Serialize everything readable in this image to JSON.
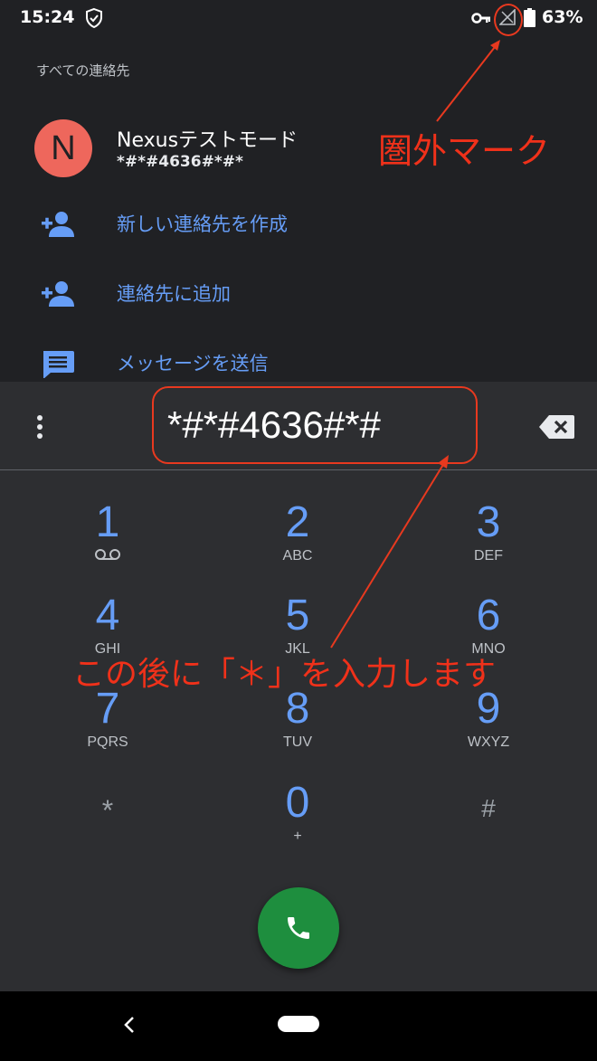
{
  "status_bar": {
    "time": "15:24",
    "battery_percent": "63%",
    "icons": [
      "shield-check-icon",
      "vpn-key-icon",
      "no-signal-icon",
      "battery-icon"
    ]
  },
  "suggestions": {
    "header": "すべての連絡先",
    "contact": {
      "avatar_letter": "N",
      "avatar_color": "#ee675c",
      "name": "Nexusテストモード",
      "number": "*#*#4636#*#*"
    },
    "actions": [
      {
        "label": "新しい連絡先を作成",
        "icon": "person-add-icon"
      },
      {
        "label": "連絡先に追加",
        "icon": "person-add-icon"
      },
      {
        "label": "メッセージを送信",
        "icon": "message-icon"
      }
    ]
  },
  "dialer": {
    "entered_digits": "*#*#4636#*#",
    "keys": [
      {
        "digit": "1",
        "sub": ""
      },
      {
        "digit": "2",
        "sub": "ABC"
      },
      {
        "digit": "3",
        "sub": "DEF"
      },
      {
        "digit": "4",
        "sub": "GHI"
      },
      {
        "digit": "5",
        "sub": "JKL"
      },
      {
        "digit": "6",
        "sub": "MNO"
      },
      {
        "digit": "7",
        "sub": "PQRS"
      },
      {
        "digit": "8",
        "sub": "TUV"
      },
      {
        "digit": "9",
        "sub": "WXYZ"
      },
      {
        "digit": "*",
        "sub": ""
      },
      {
        "digit": "0",
        "sub": "+"
      },
      {
        "digit": "#",
        "sub": ""
      }
    ],
    "accent_color": "#669df6",
    "call_color": "#1e8e3e"
  },
  "annotations": {
    "no_signal_label": "圏外マーク",
    "instruction": "この後に「＊」を入力します",
    "color": "#e8391f"
  }
}
